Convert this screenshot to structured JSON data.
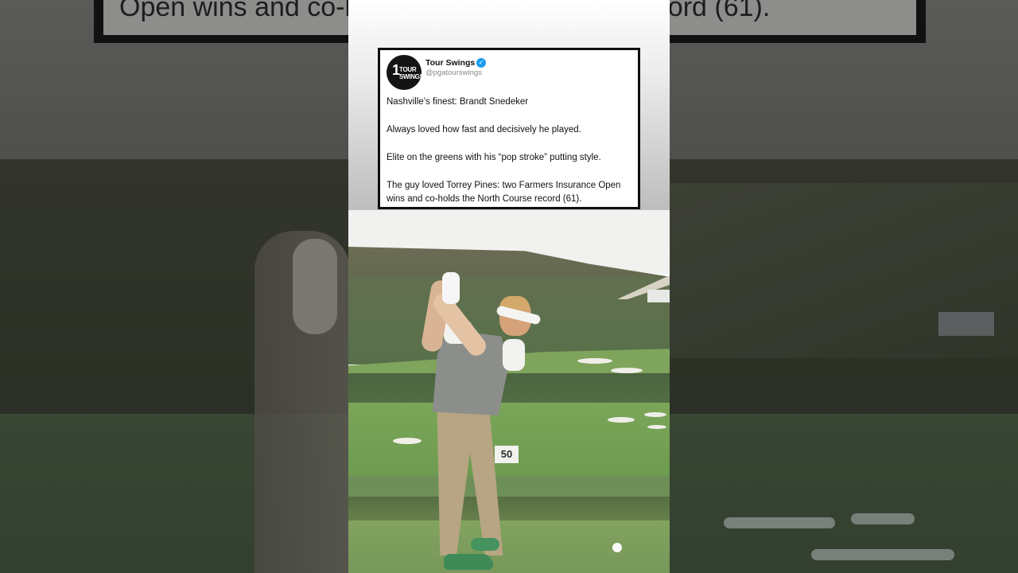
{
  "background": {
    "banner_text": "Open wins and co-holds the North Course record (61)."
  },
  "tweet": {
    "avatar_text": {
      "digit": "1",
      "line1": "TOUR",
      "line2": "SWINGS"
    },
    "username": "Tour Swings",
    "verified_mark": "✓",
    "handle": "@pgatourswings",
    "paragraphs": [
      "Nashville’s finest: Brandt Snedeker",
      "Always loved how fast and decisively he played.",
      "Elite on the greens with his “pop stroke” putting style.",
      "The guy loved Torrey Pines: two Farmers Insurance Open wins and co-holds the North Course record (61)."
    ]
  },
  "photo": {
    "sign_text": "50"
  }
}
